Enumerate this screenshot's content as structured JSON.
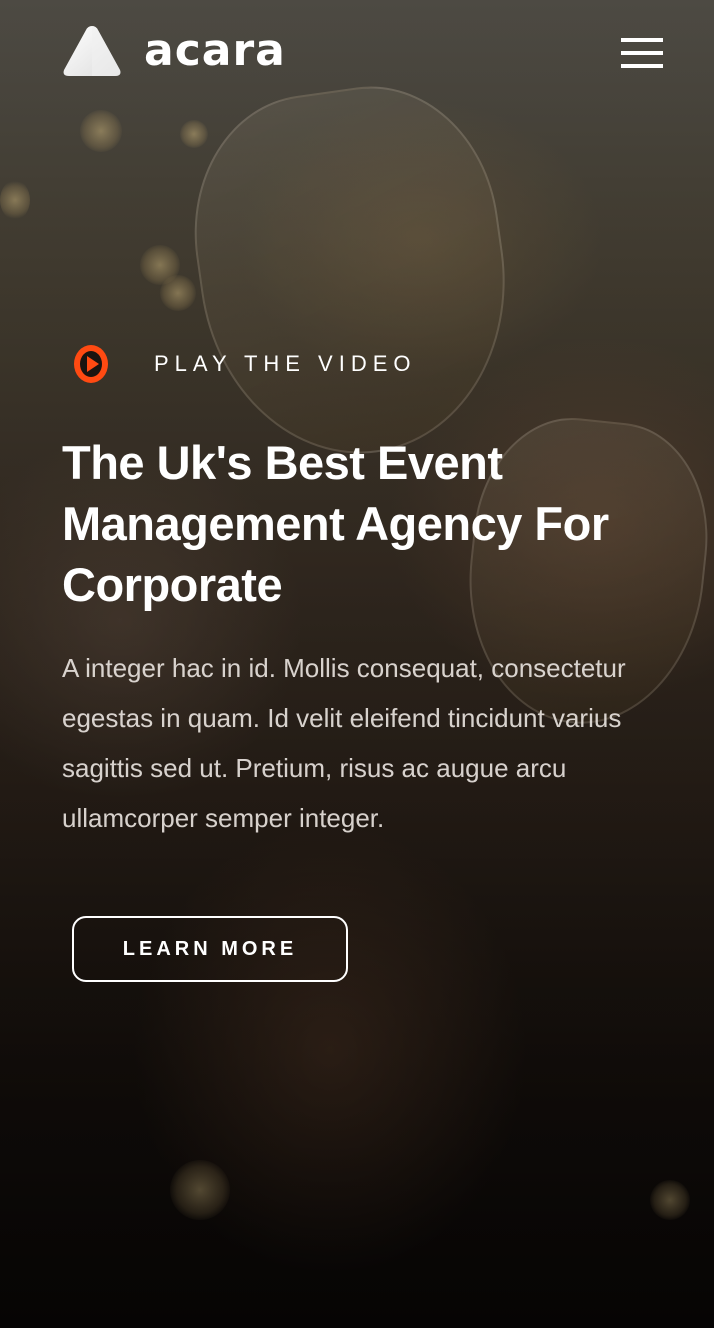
{
  "brand": {
    "name": "acara",
    "logo_icon": "triangle-logo-icon"
  },
  "header": {
    "menu_icon": "hamburger-menu-icon"
  },
  "hero": {
    "video_link": {
      "icon": "play-circle-icon",
      "label": "PLAY THE VIDEO",
      "accent_color": "#ff4a12"
    },
    "title": "The Uk's Best Event Management Agency For Corporate",
    "description": "A integer hac in id. Mollis consequat, consectetur egestas in quam. Id velit eleifend tincidunt varius sagittis sed ut. Pretium, risus ac augue arcu ullamcorper semper integer.",
    "cta_label": "LEARN MORE"
  },
  "colors": {
    "text": "#ffffff",
    "accent": "#ff4a12"
  }
}
